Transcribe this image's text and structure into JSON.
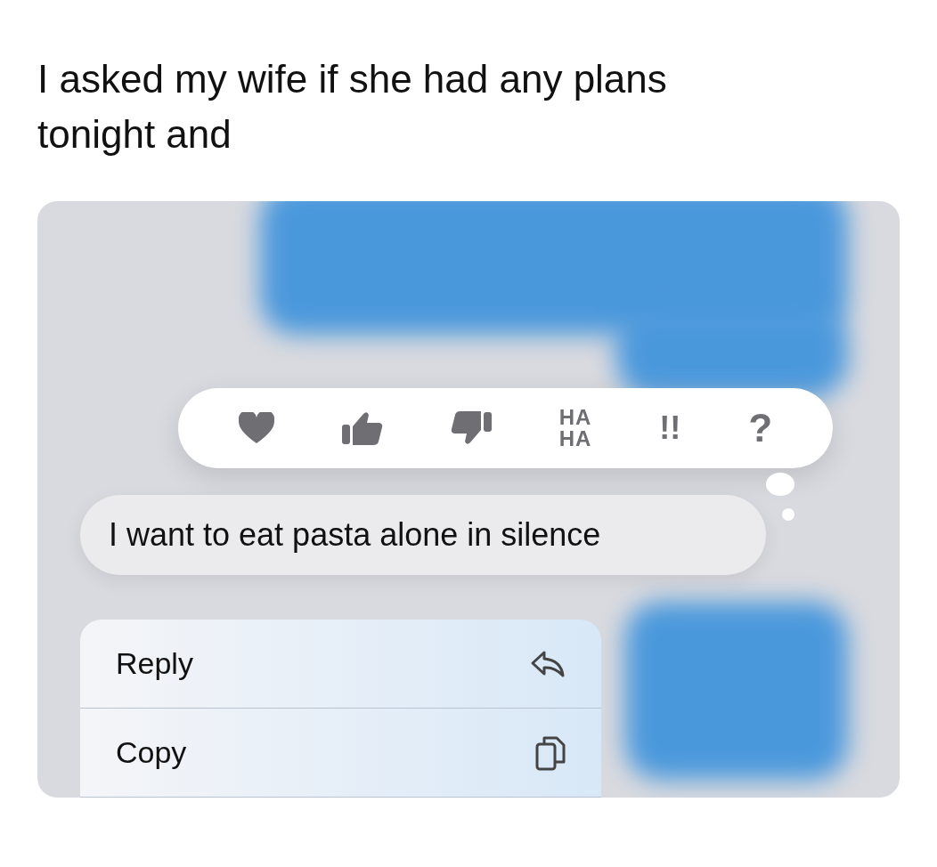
{
  "caption": "I asked my wife if she had any plans tonight and",
  "reactions": [
    {
      "kind": "heart"
    },
    {
      "kind": "thumbs-up"
    },
    {
      "kind": "thumbs-down"
    },
    {
      "kind": "haha",
      "lines": [
        "HA",
        "HA"
      ]
    },
    {
      "kind": "emphasis",
      "text": "!!"
    },
    {
      "kind": "question",
      "text": "?"
    }
  ],
  "message": {
    "text": "I want to eat pasta alone in silence"
  },
  "menu": [
    {
      "label": "Reply",
      "kind": "reply"
    },
    {
      "label": "Copy",
      "kind": "copy"
    }
  ]
}
